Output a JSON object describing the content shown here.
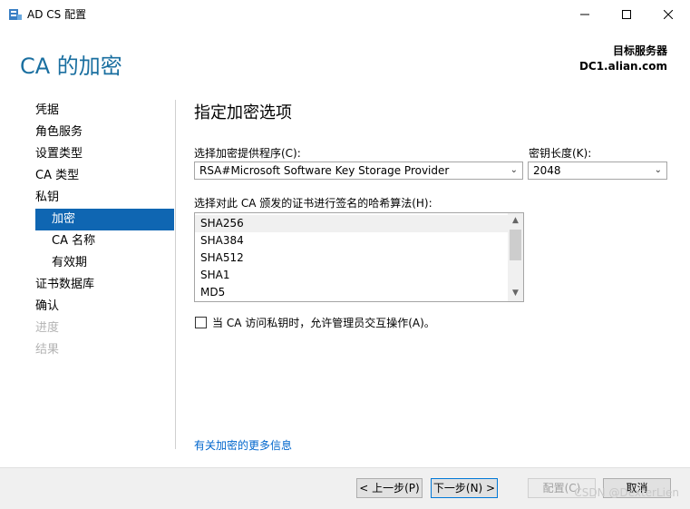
{
  "window": {
    "title": "AD CS 配置"
  },
  "header": {
    "page_title": "CA 的加密",
    "server_label": "目标服务器",
    "server_name": "DC1.alian.com"
  },
  "nav": {
    "items": [
      {
        "label": "凭据"
      },
      {
        "label": "角色服务"
      },
      {
        "label": "设置类型"
      },
      {
        "label": "CA 类型"
      },
      {
        "label": "私钥"
      },
      {
        "label": "加密"
      },
      {
        "label": "CA 名称"
      },
      {
        "label": "有效期"
      },
      {
        "label": "证书数据库"
      },
      {
        "label": "确认"
      },
      {
        "label": "进度"
      },
      {
        "label": "结果"
      }
    ],
    "selected": "加密"
  },
  "main": {
    "section_title": "指定加密选项",
    "provider_label": "选择加密提供程序(C):",
    "provider_value": "RSA#Microsoft Software Key Storage Provider",
    "keylength_label": "密钥长度(K):",
    "keylength_value": "2048",
    "hash_label": "选择对此 CA 颁发的证书进行签名的哈希算法(H):",
    "hash_options": [
      "SHA256",
      "SHA384",
      "SHA512",
      "SHA1",
      "MD5"
    ],
    "hash_selected": "SHA256",
    "interact_label": "当 CA 访问私钥时，允许管理员交互操作(A)。",
    "interact_checked": false,
    "more_link": "有关加密的更多信息"
  },
  "footer": {
    "prev_label": "< 上一步(P)",
    "next_label": "下一步(N) >",
    "configure_label": "配置(C)",
    "cancel_label": "取消"
  },
  "watermark": "CSDN @DexterLien",
  "colors": {
    "accent": "#0f66b2",
    "title": "#1a6fa0",
    "link": "#0066cc"
  }
}
